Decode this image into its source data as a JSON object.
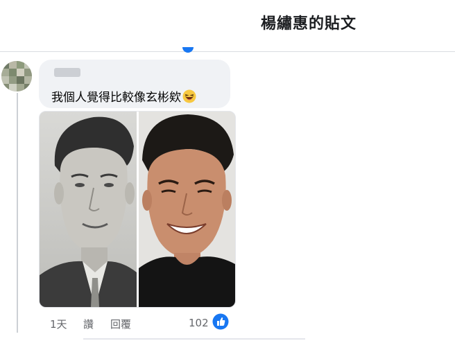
{
  "header": {
    "title": "楊繡惠的貼文"
  },
  "comment": {
    "text": "我個人覺得比較像玄彬欸",
    "emoji": "laughing-emoji",
    "photo": {
      "description_icon": "comparison-photo"
    },
    "actions": {
      "time": "1天",
      "like": "讚",
      "reply": "回覆"
    },
    "reactions": {
      "count": "102",
      "icon": "like-icon"
    }
  },
  "colors": {
    "accent": "#1877f2",
    "bubble": "#f0f2f5",
    "secondary_text": "#65676b"
  }
}
